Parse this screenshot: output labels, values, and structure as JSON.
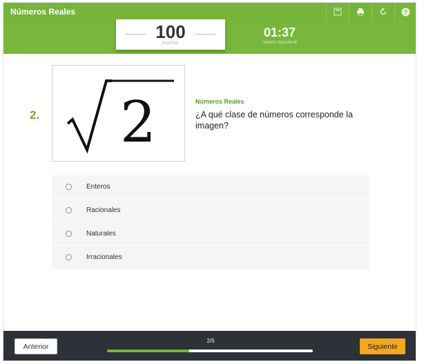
{
  "header": {
    "title": "Números Reales",
    "icons": [
      "fullscreen-icon",
      "print-icon",
      "restart-icon",
      "help-icon"
    ]
  },
  "score": {
    "value": "100",
    "label": "PUNTOS"
  },
  "timer": {
    "value": "01:37",
    "label": "TIEMPO RESTANTE"
  },
  "question": {
    "number": "2.",
    "category": "Números Reales",
    "text": "¿A qué clase de números corresponde la imagen?",
    "image_text": "√2"
  },
  "options": [
    {
      "label": "Enteros"
    },
    {
      "label": "Racionales"
    },
    {
      "label": "Naturales"
    },
    {
      "label": "Irracionales"
    }
  ],
  "footer": {
    "prev_label": "Anterior",
    "next_label": "Siguiente",
    "progress_label": "2/5",
    "progress_fraction": 0.4
  },
  "colors": {
    "accent": "#76b53a",
    "button_next": "#f5a623",
    "footer_bg": "#2d3138"
  }
}
